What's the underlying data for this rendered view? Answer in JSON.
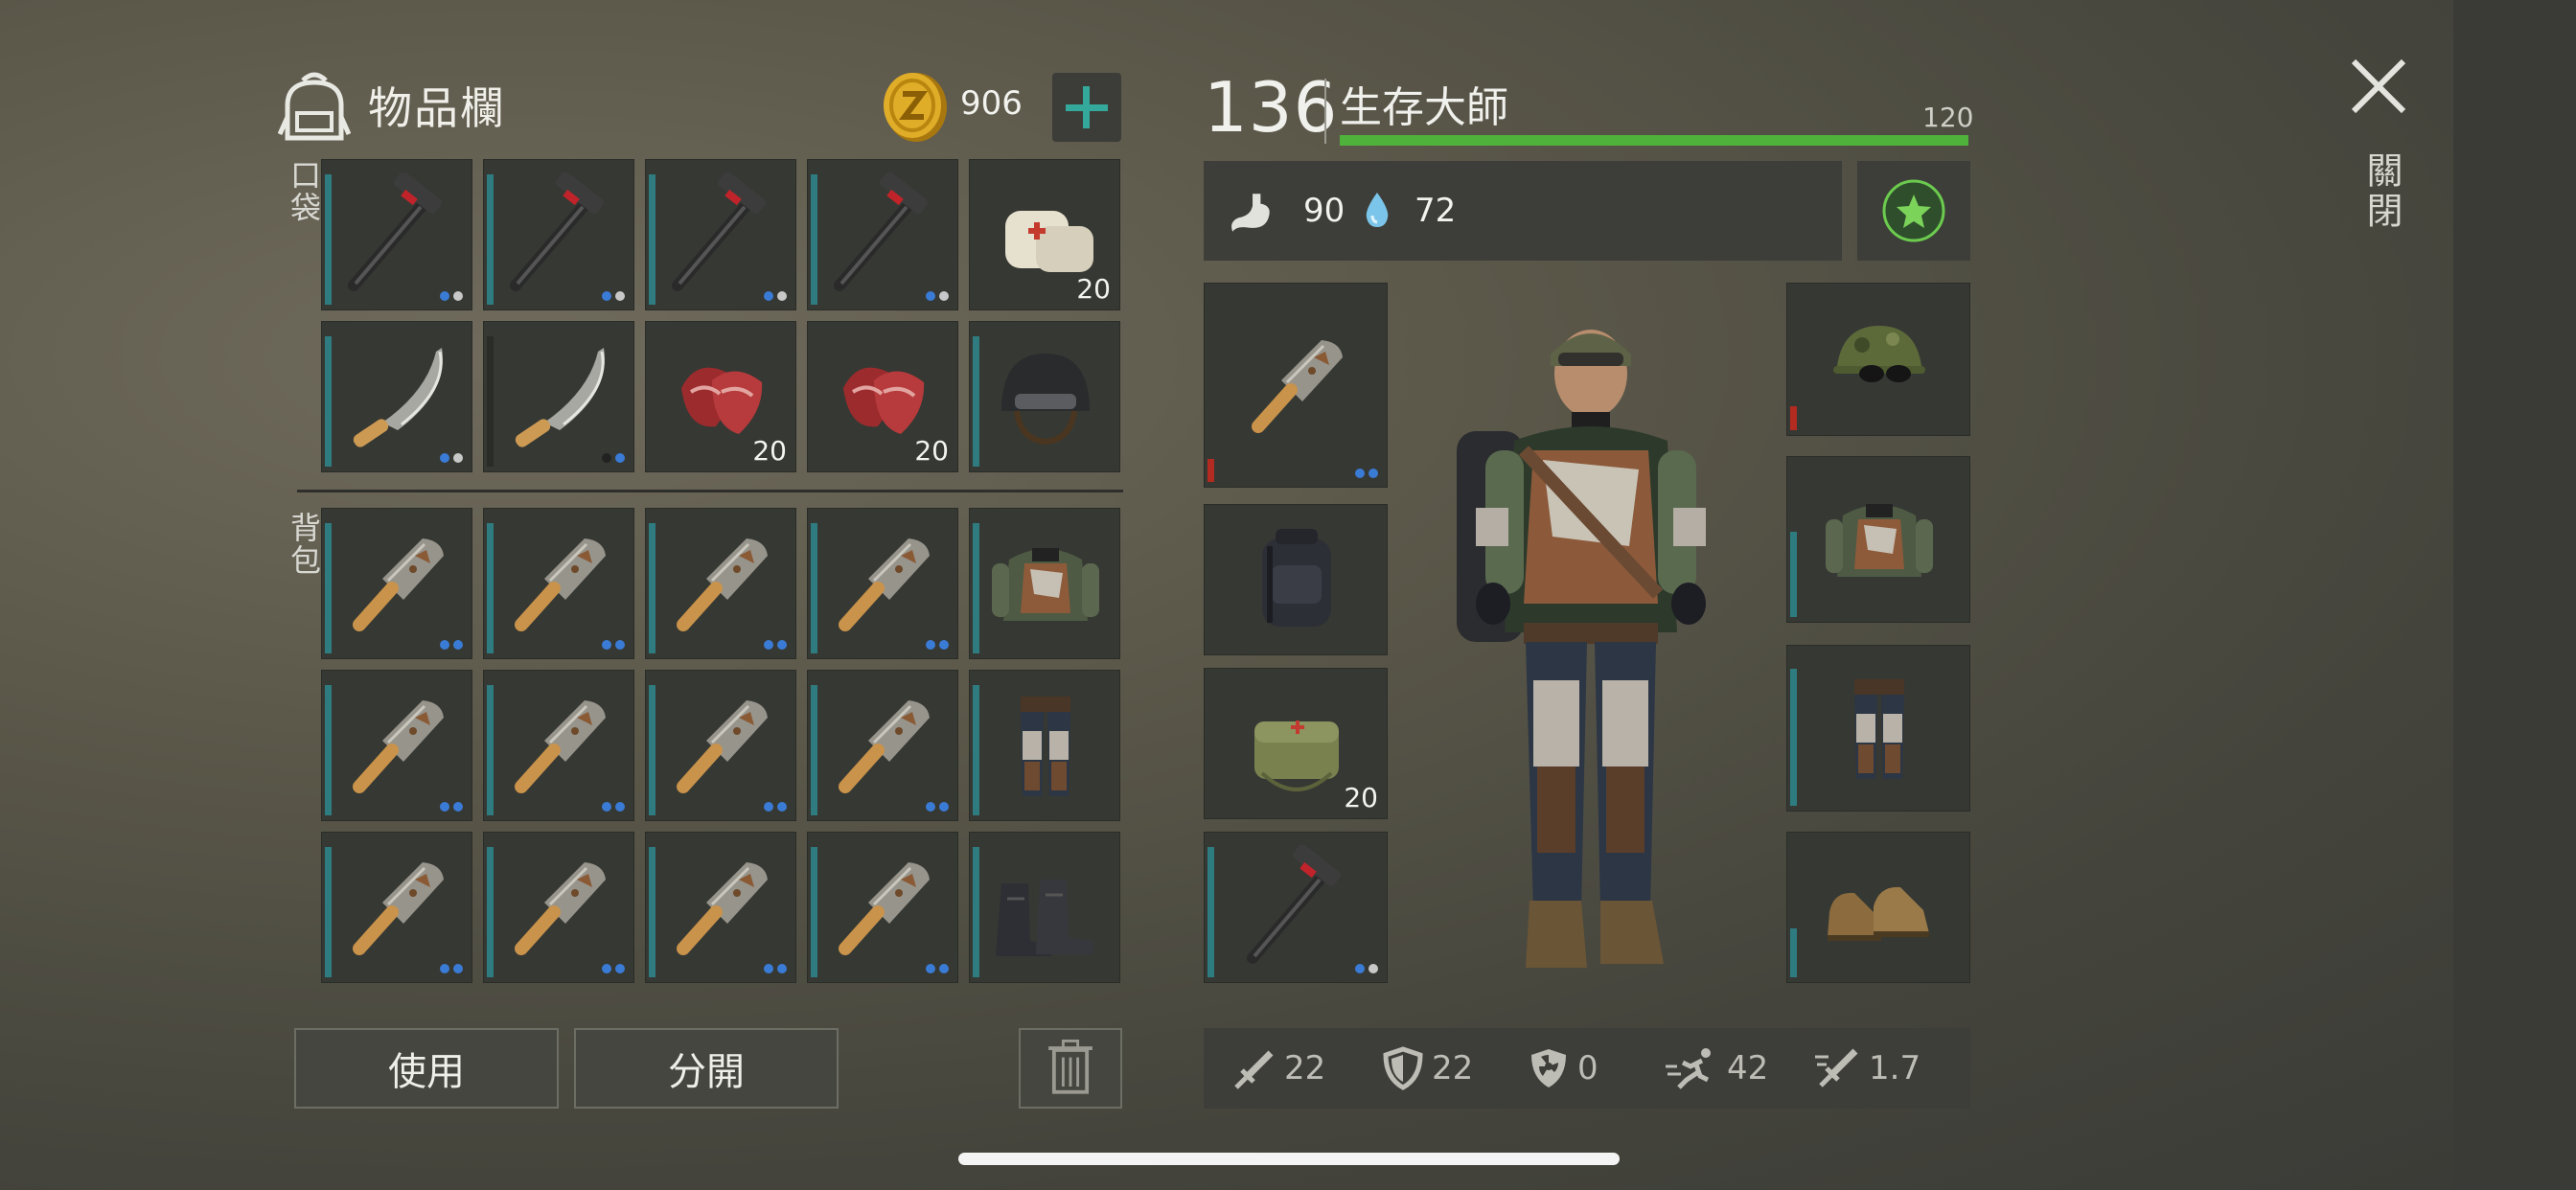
{
  "inventory": {
    "title": "物品欄",
    "coins": "906",
    "pocket_label": "口袋",
    "backpack_label": "背包",
    "pocket_slots": [
      {
        "item": "hammer-icon",
        "qty": "",
        "dots": [
          "b",
          "w"
        ],
        "dur": 0.93,
        "durColor": "teal"
      },
      {
        "item": "hammer-icon",
        "qty": "",
        "dots": [
          "b",
          "w"
        ],
        "dur": 0.93,
        "durColor": "teal"
      },
      {
        "item": "hammer-icon",
        "qty": "",
        "dots": [
          "b",
          "w"
        ],
        "dur": 0.93,
        "durColor": "teal"
      },
      {
        "item": "hammer-icon",
        "qty": "",
        "dots": [
          "b",
          "w"
        ],
        "dur": 0.93,
        "durColor": "teal"
      },
      {
        "item": "bandage-icon",
        "qty": "20",
        "dots": [],
        "dur": 0,
        "durColor": "teal"
      },
      {
        "item": "machete-icon",
        "qty": "",
        "dots": [
          "b",
          "w"
        ],
        "dur": 0.93,
        "durColor": "teal"
      },
      {
        "item": "machete-icon",
        "qty": "",
        "dots": [
          "d",
          "b"
        ],
        "dur": 0.93,
        "durColor": "dark"
      },
      {
        "item": "raw-meat-icon",
        "qty": "20",
        "dots": [],
        "dur": 0,
        "durColor": "teal"
      },
      {
        "item": "raw-meat-icon",
        "qty": "20",
        "dots": [],
        "dur": 0,
        "durColor": "teal"
      },
      {
        "item": "military-helmet-icon",
        "qty": "",
        "dots": [],
        "dur": 0.93,
        "durColor": "teal"
      }
    ],
    "backpack_slots": [
      {
        "item": "cleaver-icon",
        "qty": "",
        "dots": [
          "b",
          "b"
        ],
        "dur": 0.93,
        "durColor": "teal"
      },
      {
        "item": "cleaver-icon",
        "qty": "",
        "dots": [
          "b",
          "b"
        ],
        "dur": 0.93,
        "durColor": "teal"
      },
      {
        "item": "cleaver-icon",
        "qty": "",
        "dots": [
          "b",
          "b"
        ],
        "dur": 0.93,
        "durColor": "teal"
      },
      {
        "item": "cleaver-icon",
        "qty": "",
        "dots": [
          "b",
          "b"
        ],
        "dur": 0.93,
        "durColor": "teal"
      },
      {
        "item": "jacket-icon",
        "qty": "",
        "dots": [],
        "dur": 0.93,
        "durColor": "teal"
      },
      {
        "item": "cleaver-icon",
        "qty": "",
        "dots": [
          "b",
          "b"
        ],
        "dur": 0.93,
        "durColor": "teal"
      },
      {
        "item": "cleaver-icon",
        "qty": "",
        "dots": [
          "b",
          "b"
        ],
        "dur": 0.93,
        "durColor": "teal"
      },
      {
        "item": "cleaver-icon",
        "qty": "",
        "dots": [
          "b",
          "b"
        ],
        "dur": 0.93,
        "durColor": "teal"
      },
      {
        "item": "cleaver-icon",
        "qty": "",
        "dots": [
          "b",
          "b"
        ],
        "dur": 0.93,
        "durColor": "teal"
      },
      {
        "item": "pants-icon",
        "qty": "",
        "dots": [],
        "dur": 0.93,
        "durColor": "teal"
      },
      {
        "item": "cleaver-icon",
        "qty": "",
        "dots": [
          "b",
          "b"
        ],
        "dur": 0.93,
        "durColor": "teal"
      },
      {
        "item": "cleaver-icon",
        "qty": "",
        "dots": [
          "b",
          "b"
        ],
        "dur": 0.93,
        "durColor": "teal"
      },
      {
        "item": "cleaver-icon",
        "qty": "",
        "dots": [
          "b",
          "b"
        ],
        "dur": 0.93,
        "durColor": "teal"
      },
      {
        "item": "cleaver-icon",
        "qty": "",
        "dots": [
          "b",
          "b"
        ],
        "dur": 0.93,
        "durColor": "teal"
      },
      {
        "item": "boots-icon",
        "qty": "",
        "dots": [],
        "dur": 0.93,
        "durColor": "teal"
      }
    ],
    "use_button": "使用",
    "split_button": "分開"
  },
  "character": {
    "level": "136",
    "rank_title": "生存大師",
    "xp_max": "120",
    "xp_fraction": 1.0,
    "hunger": "90",
    "thirst": "72",
    "equip_left": [
      {
        "item": "cleaver-icon",
        "qty": "",
        "dots": [
          "b",
          "b"
        ],
        "dur": 0.12,
        "durColor": "red"
      },
      {
        "item": "backpack-icon",
        "qty": "",
        "dots": [],
        "dur": 0,
        "durColor": "teal"
      },
      {
        "item": "medkit-bag-icon",
        "qty": "20",
        "dots": [],
        "dur": 0,
        "durColor": "teal"
      },
      {
        "item": "hammer-icon",
        "qty": "",
        "dots": [
          "b",
          "w"
        ],
        "dur": 0.93,
        "durColor": "teal"
      }
    ],
    "equip_right": [
      {
        "item": "camo-hat-icon",
        "qty": "",
        "dots": [],
        "dur": 0.17,
        "durColor": "red"
      },
      {
        "item": "jacket-icon",
        "qty": "",
        "dots": [],
        "dur": 0.55,
        "durColor": "teal"
      },
      {
        "item": "pants-icon",
        "qty": "",
        "dots": [],
        "dur": 0.88,
        "durColor": "teal"
      },
      {
        "item": "shoes-icon",
        "qty": "",
        "dots": [],
        "dur": 0.35,
        "durColor": "teal"
      }
    ],
    "stats": {
      "damage": "22",
      "armor": "22",
      "radiation": "0",
      "speed": "42",
      "attack_speed": "1.7"
    }
  },
  "close_label": "關閉",
  "colors": {
    "durability_teal": "#2f7c80",
    "durability_red": "#b32a21",
    "xp_green": "#4fb23a",
    "accent_teal": "#34a89a"
  }
}
